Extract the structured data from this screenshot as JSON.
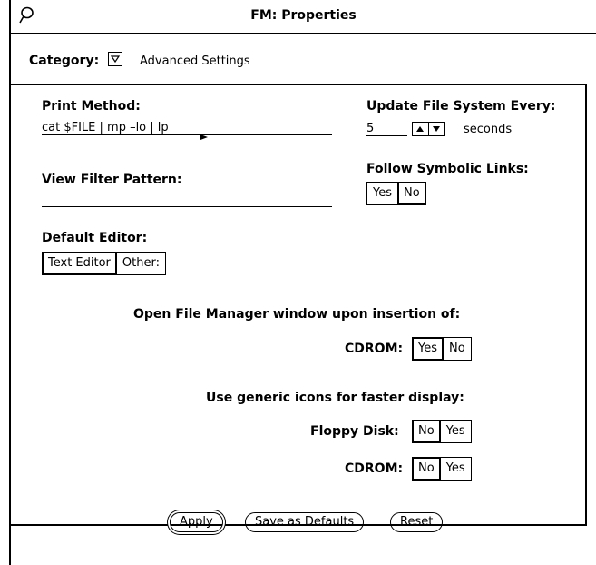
{
  "window": {
    "title": "FM: Properties"
  },
  "category": {
    "label": "Category:",
    "value": "Advanced Settings"
  },
  "print_method": {
    "label": "Print Method:",
    "value": "cat $FILE | mp –lo | lp"
  },
  "update_fs": {
    "label": "Update File System Every:",
    "value": "5",
    "unit": "seconds"
  },
  "view_filter": {
    "label": "View Filter Pattern:",
    "value": ""
  },
  "follow_links": {
    "label": "Follow Symbolic Links:",
    "options": [
      "Yes",
      "No"
    ],
    "selected": "No"
  },
  "default_editor": {
    "label": "Default Editor:",
    "options": [
      "Text Editor",
      "Other:"
    ],
    "selected": "Text Editor"
  },
  "open_fm": {
    "heading": "Open File Manager window upon insertion of:",
    "cdrom_label": "CDROM:",
    "options": [
      "Yes",
      "No"
    ],
    "selected": "Yes"
  },
  "generic_icons": {
    "heading": "Use generic icons for faster display:",
    "floppy_label": "Floppy Disk:",
    "floppy_options": [
      "No",
      "Yes"
    ],
    "floppy_selected": "No",
    "cdrom_label": "CDROM:",
    "cdrom_options": [
      "No",
      "Yes"
    ],
    "cdrom_selected": "No"
  },
  "buttons": {
    "apply": "Apply",
    "save_defaults": "Save as Defaults",
    "reset": "Reset"
  },
  "icons": {
    "window_menu": "window-menu-icon",
    "category_menu": "dropdown-triangle-icon",
    "spin_up": "spin-up-icon",
    "spin_down": "spin-down-icon"
  }
}
